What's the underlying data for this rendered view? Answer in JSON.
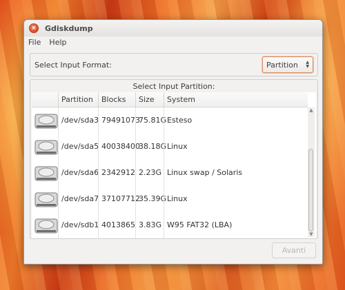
{
  "window": {
    "title": "Gdiskdump"
  },
  "menu": [
    "File",
    "Help"
  ],
  "format": {
    "label": "Select Input Format:",
    "selected": "Partition"
  },
  "partitions": {
    "header": "Select Input Partition:",
    "columns": [
      "Partition",
      "Blocks",
      "Size",
      "System"
    ],
    "rows": [
      {
        "partition": "/dev/sda3",
        "blocks": "79491073",
        "size": "75.81G",
        "system": "Esteso"
      },
      {
        "partition": "/dev/sda5",
        "blocks": "40038400",
        "size": "38.18G",
        "system": "Linux"
      },
      {
        "partition": "/dev/sda6",
        "blocks": "2342912",
        "size": "2.23G",
        "system": "Linux swap / Solaris"
      },
      {
        "partition": "/dev/sda7",
        "blocks": "37107712",
        "size": "35.39G",
        "system": "Linux"
      },
      {
        "partition": "/dev/sdb1",
        "blocks": "4013865",
        "size": "3.83G",
        "system": "W95 FAT32 (LBA)"
      }
    ]
  },
  "footer": {
    "next_label": "Avanti"
  },
  "icons": {
    "close": "close-icon",
    "disk": "hard-disk-icon"
  },
  "colors": {
    "accent": "#e9784a",
    "close": "#de4a22"
  }
}
